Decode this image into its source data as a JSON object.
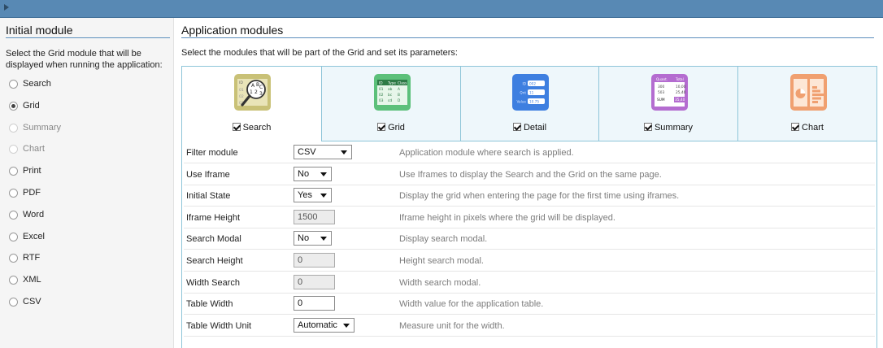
{
  "left": {
    "title": "Initial module",
    "description": "Select the Grid module that will be displayed when running the application:",
    "options": [
      {
        "label": "Search",
        "checked": false,
        "disabled": false
      },
      {
        "label": "Grid",
        "checked": true,
        "disabled": false
      },
      {
        "label": "Summary",
        "checked": false,
        "disabled": true
      },
      {
        "label": "Chart",
        "checked": false,
        "disabled": true
      },
      {
        "label": "Print",
        "checked": false,
        "disabled": false
      },
      {
        "label": "PDF",
        "checked": false,
        "disabled": false
      },
      {
        "label": "Word",
        "checked": false,
        "disabled": false
      },
      {
        "label": "Excel",
        "checked": false,
        "disabled": false
      },
      {
        "label": "RTF",
        "checked": false,
        "disabled": false
      },
      {
        "label": "XML",
        "checked": false,
        "disabled": false
      },
      {
        "label": "CSV",
        "checked": false,
        "disabled": false
      }
    ]
  },
  "right": {
    "title": "Application modules",
    "description": "Select the modules that will be part of the Grid and set its parameters:",
    "modules": [
      {
        "label": "Search",
        "checked": true,
        "active": true,
        "icon": "search-module-icon",
        "color": "#c9c177",
        "icon_text": [
          "ID",
          "01",
          "02",
          "03",
          "A",
          "B",
          "C",
          "1",
          "2",
          "3"
        ]
      },
      {
        "label": "Grid",
        "checked": true,
        "active": false,
        "icon": "grid-module-icon",
        "color": "#5cc07a",
        "icon_text": [
          "ID",
          "Type",
          "Class",
          "01",
          "ab",
          "A",
          "02",
          "bc",
          "B",
          "03",
          "cd",
          "D"
        ]
      },
      {
        "label": "Detail",
        "checked": true,
        "active": false,
        "icon": "detail-module-icon",
        "color": "#3e7fe0",
        "icon_text": [
          "ID",
          "002",
          "Qnt",
          "11",
          "Value",
          "10.75"
        ]
      },
      {
        "label": "Summary",
        "checked": true,
        "active": false,
        "icon": "summary-module-icon",
        "color": "#b46cd0",
        "icon_text": [
          "Quant.",
          "Total",
          "300",
          "10,00",
          "503",
          "25,40",
          "SUM",
          "35,40"
        ]
      },
      {
        "label": "Chart",
        "checked": true,
        "active": false,
        "icon": "chart-module-icon",
        "color": "#f0a070",
        "icon_text": []
      }
    ],
    "settings": [
      {
        "label": "Filter module",
        "type": "select",
        "value": "CSV",
        "width": 72,
        "disabled": false,
        "hint": "Application module where search is applied."
      },
      {
        "label": "Use Iframe",
        "type": "select",
        "value": "No",
        "width": 47,
        "disabled": false,
        "hint": "Use Iframes to display the Search and the Grid on the same page."
      },
      {
        "label": "Initial State",
        "type": "select",
        "value": "Yes",
        "width": 47,
        "disabled": false,
        "hint": "Display the grid when entering the page for the first time using iframes."
      },
      {
        "label": "Iframe Height",
        "type": "input",
        "value": "1500",
        "width": 51,
        "disabled": true,
        "hint": "Iframe height in pixels where the grid will be displayed."
      },
      {
        "label": "Search Modal",
        "type": "select",
        "value": "No",
        "width": 47,
        "disabled": false,
        "hint": "Display search modal."
      },
      {
        "label": "Search Height",
        "type": "input",
        "value": "0",
        "width": 51,
        "disabled": true,
        "hint": "Height search modal."
      },
      {
        "label": "Width Search",
        "type": "input",
        "value": "0",
        "width": 51,
        "disabled": true,
        "hint": "Width search modal."
      },
      {
        "label": "Table Width",
        "type": "input",
        "value": "0",
        "width": 51,
        "disabled": false,
        "hint": "Width value for the application table."
      },
      {
        "label": "Table Width Unit",
        "type": "select",
        "value": "Automatic",
        "width": 75,
        "disabled": false,
        "hint": "Measure unit for the width."
      }
    ]
  }
}
